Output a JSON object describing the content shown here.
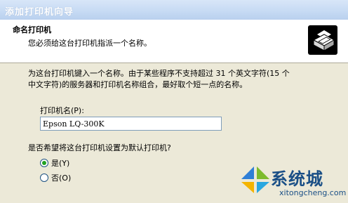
{
  "window": {
    "title": "添加打印机向导"
  },
  "header": {
    "title": "命名打印机",
    "subtitle": "您必须给这台打印机指派一个名称。"
  },
  "description_line1": "为这台打印机键入一个名称。由于某些程序不支持超过 31 个英文字符(15 个",
  "description_line2": "中文字符)的服务器和打印机名称组合，最好取个短一点的名称。",
  "printer_name": {
    "label": "打印机名(P):",
    "value": "Epson LQ-300K"
  },
  "default_question": "是否希望将这台打印机设置为默认打印机?",
  "options": {
    "yes_label": "是(Y)",
    "no_label": "否(O)",
    "selected": "yes"
  },
  "watermark": {
    "text": "系统城",
    "url": "xitongcheng.com"
  },
  "colors": {
    "title_bar": "#c7dbf4",
    "dialog_bg": "#ece9d8",
    "header_bg": "#ffffff",
    "radio_selected": "#21a121",
    "watermark": "#1a4f86"
  }
}
